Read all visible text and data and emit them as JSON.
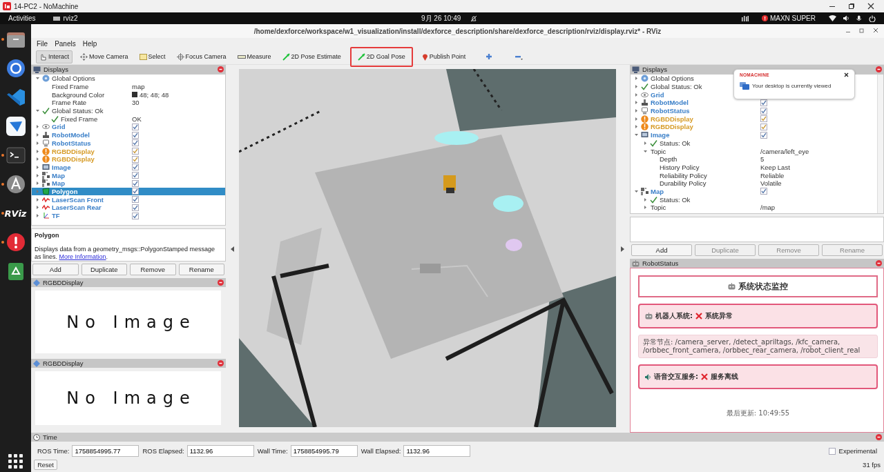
{
  "window": {
    "title": "14-PC2 - NoMachine"
  },
  "top_bar": {
    "activities": "Activities",
    "app": "rviz2",
    "clock": "9月 26  10:49",
    "power_mode": "MAXN SUPER"
  },
  "dock": [
    {
      "kind": "files",
      "running": true
    },
    {
      "kind": "browser",
      "running": false
    },
    {
      "kind": "editor",
      "running": false
    },
    {
      "kind": "bird",
      "running": false
    },
    {
      "kind": "terminal",
      "running": true
    },
    {
      "kind": "software",
      "running": true
    },
    {
      "kind": "rviz",
      "label": "RViz",
      "running": true
    },
    {
      "kind": "alert",
      "running": true
    },
    {
      "kind": "trash",
      "running": false
    },
    {
      "kind": "apps"
    }
  ],
  "rviz": {
    "title": "/home/dexforce/workspace/w1_visualization/install/dexforce_description/share/dexforce_description/rviz/display.rviz* - RViz",
    "menu": [
      "File",
      "Panels",
      "Help"
    ],
    "tools": [
      {
        "label": "Interact",
        "kind": "interact",
        "selected": true,
        "highlighted": false
      },
      {
        "label": "Move Camera",
        "kind": "camera",
        "selected": false,
        "highlighted": false
      },
      {
        "label": "Select",
        "kind": "select",
        "selected": false,
        "highlighted": false
      },
      {
        "label": "Focus Camera",
        "kind": "focus",
        "selected": false,
        "highlighted": false
      },
      {
        "label": "Measure",
        "kind": "measure",
        "selected": false,
        "highlighted": false
      },
      {
        "label": "2D Pose Estimate",
        "kind": "pose",
        "selected": false,
        "highlighted": false
      },
      {
        "label": "2D Goal Pose",
        "kind": "pose",
        "selected": false,
        "highlighted": true
      },
      {
        "label": "Publish Point",
        "kind": "point",
        "selected": false,
        "highlighted": false
      }
    ],
    "left_displays": {
      "title": "Displays",
      "tree": [
        {
          "label": "Global Options",
          "kind": "options",
          "expanded": true,
          "selected": false,
          "children": [
            {
              "label": "Fixed Frame",
              "kind": "property",
              "value": "map",
              "selected": false
            },
            {
              "label": "Background Color",
              "kind": "property",
              "value": "48; 48; 48",
              "color": "#303030",
              "selected": false
            },
            {
              "label": "Frame Rate",
              "kind": "property",
              "value": "30",
              "selected": false
            }
          ]
        },
        {
          "label": "Global Status: Ok",
          "kind": "status",
          "expanded": true,
          "selected": false,
          "children": [
            {
              "label": "Fixed Frame",
              "kind": "status",
              "value": "OK",
              "selected": false
            }
          ]
        },
        {
          "label": "Grid",
          "kind": "grid",
          "expanded": false,
          "checked": true,
          "selected": false
        },
        {
          "label": "RobotModel",
          "kind": "robot_model",
          "expanded": false,
          "checked": true,
          "selected": false
        },
        {
          "label": "RobotStatus",
          "kind": "robot_status",
          "expanded": false,
          "checked": true,
          "selected": false
        },
        {
          "label": "RGBDDisplay",
          "kind": "warning",
          "expanded": false,
          "checked": true,
          "selected": false
        },
        {
          "label": "RGBDDisplay",
          "kind": "warning",
          "expanded": false,
          "checked": true,
          "selected": false
        },
        {
          "label": "Image",
          "kind": "image",
          "expanded": false,
          "checked": true,
          "selected": false
        },
        {
          "label": "Map",
          "kind": "map",
          "expanded": false,
          "checked": true,
          "selected": false
        },
        {
          "label": "Map",
          "kind": "map",
          "expanded": false,
          "checked": true,
          "selected": false
        },
        {
          "label": "Polygon",
          "kind": "polygon",
          "expanded": false,
          "checked": true,
          "selected": true
        },
        {
          "label": "LaserScan Front",
          "kind": "laser",
          "expanded": false,
          "checked": true,
          "selected": false
        },
        {
          "label": "LaserScan Rear",
          "kind": "laser",
          "expanded": false,
          "checked": true,
          "selected": false
        },
        {
          "label": "TF",
          "kind": "tf",
          "expanded": false,
          "checked": true,
          "selected": false
        }
      ],
      "description": {
        "title": "Polygon",
        "text": "Displays data from a geometry_msgs::PolygonStamped message as lines.",
        "link": "More Information",
        "end": "."
      },
      "buttons": [
        {
          "label": "Add",
          "disabled": false
        },
        {
          "label": "Duplicate",
          "disabled": false
        },
        {
          "label": "Remove",
          "disabled": false
        },
        {
          "label": "Rename",
          "disabled": false
        }
      ]
    },
    "image_panels": [
      {
        "title": "RGBDDisplay",
        "message": "No Image"
      },
      {
        "title": "RGBDDisplay",
        "message": "No Image"
      }
    ],
    "right_displays": {
      "title": "Displays",
      "tree": [
        {
          "label": "Global Options",
          "kind": "options",
          "expanded": false,
          "selected": false
        },
        {
          "label": "Global Status: Ok",
          "kind": "status",
          "expanded": false,
          "selected": false
        },
        {
          "label": "Grid",
          "kind": "grid",
          "expanded": false,
          "selected": false
        },
        {
          "label": "RobotModel",
          "kind": "robot_model",
          "expanded": false,
          "checked": true,
          "selected": false
        },
        {
          "label": "RobotStatus",
          "kind": "robot_status",
          "expanded": false,
          "checked": true,
          "selected": false
        },
        {
          "label": "RGBDDisplay",
          "kind": "warning",
          "expanded": false,
          "checked": true,
          "selected": false
        },
        {
          "label": "RGBDDisplay",
          "kind": "warning",
          "expanded": false,
          "checked": true,
          "selected": false
        },
        {
          "label": "Image",
          "kind": "image",
          "expanded": true,
          "checked": true,
          "selected": false,
          "children": [
            {
              "label": "Status: Ok",
              "kind": "status",
              "expanded": false,
              "selected": false
            },
            {
              "label": "Topic",
              "kind": "property",
              "value": "/camera/left_eye",
              "expanded": true,
              "selected": false,
              "children": [
                {
                  "label": "Depth",
                  "kind": "property",
                  "value": "5",
                  "selected": false
                },
                {
                  "label": "History Policy",
                  "kind": "property",
                  "value": "Keep Last",
                  "selected": false
                },
                {
                  "label": "Reliability Policy",
                  "kind": "property",
                  "value": "Reliable",
                  "selected": false
                },
                {
                  "label": "Durability Policy",
                  "kind": "property",
                  "value": "Volatile",
                  "selected": false
                }
              ]
            }
          ]
        },
        {
          "label": "Map",
          "kind": "map",
          "expanded": true,
          "checked": true,
          "selected": false,
          "children": [
            {
              "label": "Status: Ok",
              "kind": "status",
              "expanded": false,
              "selected": false
            },
            {
              "label": "Topic",
              "kind": "property",
              "value": "/map",
              "expanded": false,
              "selected": false
            }
          ]
        }
      ],
      "buttons": [
        {
          "label": "Add",
          "disabled": false
        },
        {
          "label": "Duplicate",
          "disabled": true
        },
        {
          "label": "Remove",
          "disabled": true
        },
        {
          "label": "Rename",
          "disabled": true
        }
      ]
    },
    "notification": {
      "brand": "NOMACHINE",
      "message": "Your desktop is currently viewed"
    },
    "robot_status": {
      "title": "RobotStatus",
      "header": "系统状态监控",
      "cards": [
        {
          "kind": "error",
          "label": "机器人系统:",
          "state": "系统异常"
        },
        {
          "kind": "note",
          "text": "异常节点: /camera_server, /detect_apriltags, /kfc_camera, /orbbec_front_camera, /orbbec_rear_camera, /robot_client_real"
        },
        {
          "kind": "error",
          "label": "语音交互服务:",
          "state": "服务离线"
        }
      ],
      "updated": "最后更新: 10:49:55"
    },
    "time": {
      "title": "Time",
      "fields": [
        {
          "label": "ROS Time:",
          "value": "1758854995.77"
        },
        {
          "label": "ROS Elapsed:",
          "value": "1132.96"
        },
        {
          "label": "Wall Time:",
          "value": "1758854995.79"
        },
        {
          "label": "Wall Elapsed:",
          "value": "1132.96"
        }
      ],
      "experimental": {
        "label": "Experimental",
        "checked": false
      },
      "reset": "Reset",
      "fps": "31 fps"
    }
  }
}
